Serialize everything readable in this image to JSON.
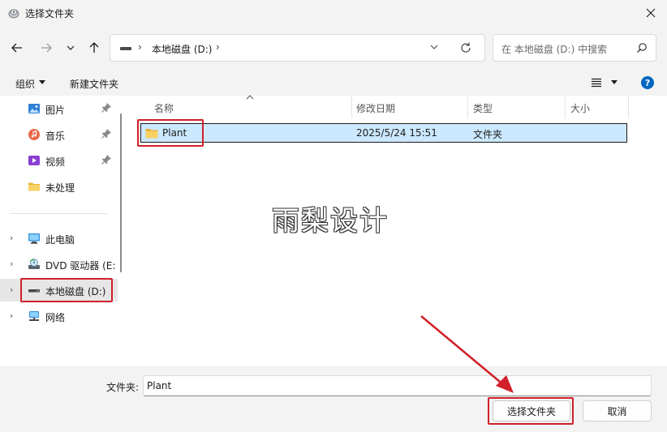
{
  "window": {
    "title": "选择文件夹"
  },
  "address": {
    "crumb": "本地磁盘 (D:)"
  },
  "search": {
    "placeholder": "在 本地磁盘 (D:) 中搜索"
  },
  "toolbar": {
    "organize": "组织",
    "new_folder": "新建文件夹"
  },
  "sidebar": {
    "items": [
      {
        "label": "图片",
        "icon": "pictures-icon",
        "pinned": true
      },
      {
        "label": "音乐",
        "icon": "music-icon",
        "pinned": true
      },
      {
        "label": "视频",
        "icon": "videos-icon",
        "pinned": true
      },
      {
        "label": "未处理",
        "icon": "folder-icon",
        "pinned": false
      },
      {
        "label": "此电脑",
        "icon": "this-pc-icon",
        "expandable": true
      },
      {
        "label": "DVD 驱动器 (E:",
        "icon": "dvd-drive-icon",
        "expandable": true
      },
      {
        "label": "本地磁盘 (D:)",
        "icon": "local-disk-icon",
        "expandable": true,
        "selected": true
      },
      {
        "label": "网络",
        "icon": "network-icon",
        "expandable": true
      }
    ]
  },
  "table": {
    "columns": [
      "名称",
      "修改日期",
      "类型",
      "大小"
    ],
    "rows": [
      {
        "name": "Plant",
        "modified": "2025/5/24 15:51",
        "type": "文件夹",
        "size": ""
      }
    ]
  },
  "watermark": "雨梨设计",
  "footer": {
    "folder_label": "文件夹:",
    "folder_value": "Plant",
    "select_button": "选择文件夹",
    "cancel_button": "取消"
  },
  "colors": {
    "accent": "#0067c0",
    "selection": "#cce8ff",
    "annotation_red": "#d0202a"
  }
}
